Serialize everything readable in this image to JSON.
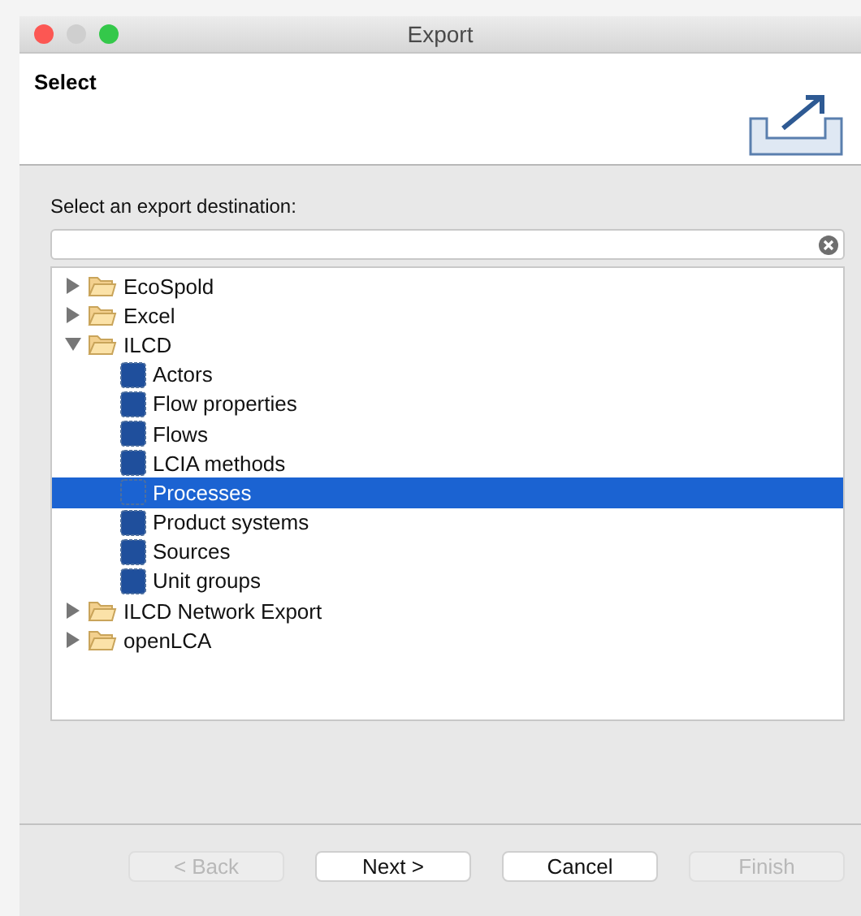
{
  "window": {
    "title": "Export"
  },
  "header": {
    "title": "Select"
  },
  "prompt": "Select an export destination:",
  "tree": [
    {
      "label": "EcoSpold",
      "kind": "folder",
      "expanded": false,
      "selected": false
    },
    {
      "label": "Excel",
      "kind": "folder",
      "expanded": false,
      "selected": false
    },
    {
      "label": "ILCD",
      "kind": "folder",
      "expanded": true,
      "selected": false,
      "children": [
        {
          "label": "Actors",
          "kind": "item",
          "selected": false
        },
        {
          "label": "Flow properties",
          "kind": "item",
          "selected": false
        },
        {
          "label": "Flows",
          "kind": "item",
          "selected": false
        },
        {
          "label": "LCIA methods",
          "kind": "item",
          "selected": false
        },
        {
          "label": "Processes",
          "kind": "item",
          "selected": true
        },
        {
          "label": "Product systems",
          "kind": "item",
          "selected": false
        },
        {
          "label": "Sources",
          "kind": "item",
          "selected": false
        },
        {
          "label": "Unit groups",
          "kind": "item",
          "selected": false
        }
      ]
    },
    {
      "label": "ILCD Network Export",
      "kind": "folder",
      "expanded": false,
      "selected": false
    },
    {
      "label": "openLCA",
      "kind": "folder",
      "expanded": false,
      "selected": false
    }
  ],
  "buttons": [
    {
      "label": "< Back",
      "disabled": true
    },
    {
      "label": "Next >",
      "disabled": false
    },
    {
      "label": "Cancel",
      "disabled": false
    },
    {
      "label": "Finish",
      "disabled": true
    }
  ]
}
